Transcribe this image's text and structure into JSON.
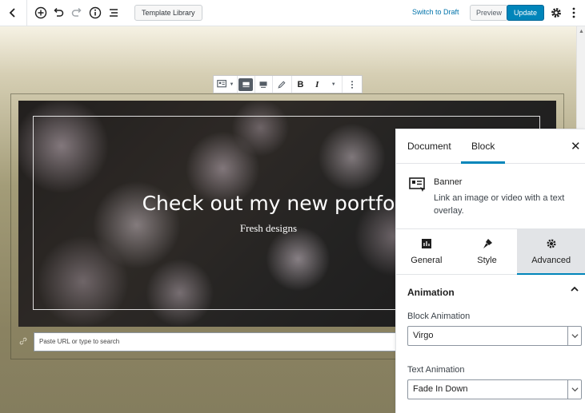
{
  "toolbar": {
    "template_library_label": "Template Library",
    "switch_to_draft_label": "Switch to Draft",
    "preview_label": "Preview",
    "update_label": "Update"
  },
  "banner": {
    "title": "Check out my new portfo",
    "subtitle": "Fresh designs"
  },
  "url_input": {
    "placeholder": "Paste URL or type to search"
  },
  "sidebar": {
    "tabs": {
      "document": "Document",
      "block": "Block"
    },
    "close_label": "✕",
    "block_card": {
      "name": "Banner",
      "description": "Link an image or video with a text overlay."
    },
    "panel_tabs": {
      "general": "General",
      "style": "Style",
      "advanced": "Advanced"
    },
    "section_title": "Animation",
    "block_animation": {
      "label": "Block Animation",
      "value": "Virgo"
    },
    "text_animation": {
      "label": "Text Animation",
      "value": "Fade In Down"
    }
  },
  "colors": {
    "accent": "#0085ba",
    "link": "#0073aa"
  },
  "icons": [
    "back-icon",
    "add-block-icon",
    "undo-icon",
    "redo-icon",
    "info-icon",
    "outline-icon",
    "gear-icon",
    "more-icon",
    "banner-block-icon",
    "align-full-icon",
    "align-wide-icon",
    "pencil-icon",
    "bold-icon",
    "italic-icon",
    "chevron-down-icon",
    "link-icon",
    "close-icon",
    "chevron-up-icon"
  ]
}
